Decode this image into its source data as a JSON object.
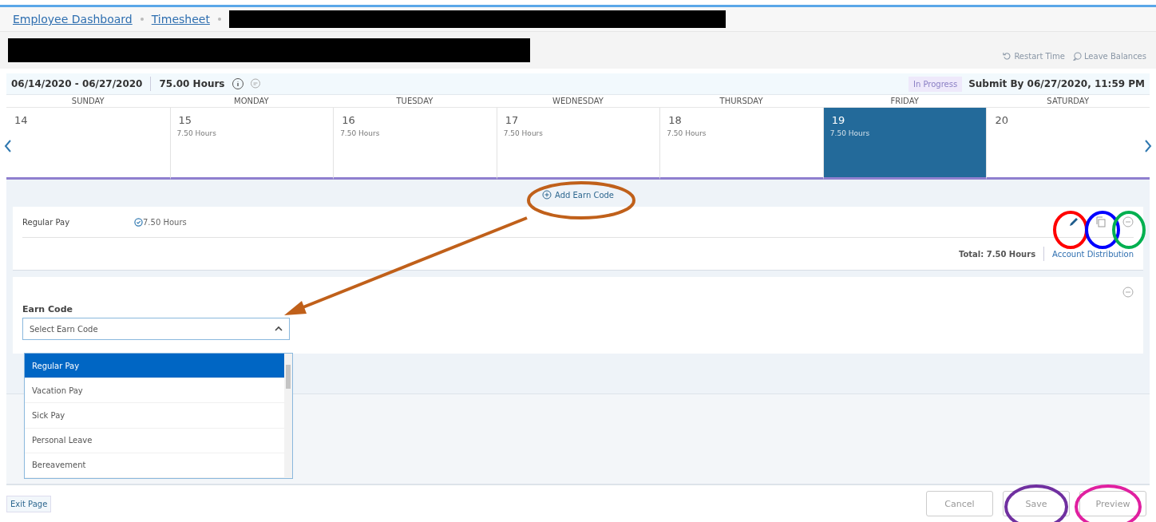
{
  "breadcrumbs": [
    {
      "label": "Employee Dashboard"
    },
    {
      "label": "Timesheet"
    }
  ],
  "header_links": [
    {
      "kind": "restart",
      "label": "Restart Time"
    },
    {
      "kind": "balances",
      "label": "Leave Balances"
    }
  ],
  "period": {
    "range": "06/14/2020 - 06/27/2020",
    "hours": "75.00 Hours",
    "status": "In Progress",
    "submit_by": "Submit By 06/27/2020, 11:59 PM"
  },
  "days": [
    {
      "weekday": "SUNDAY",
      "date": "14",
      "selected": false
    },
    {
      "weekday": "MONDAY",
      "date": "15",
      "hours": "7.50 Hours",
      "selected": false
    },
    {
      "weekday": "TUESDAY",
      "date": "16",
      "hours": "7.50 Hours",
      "selected": false
    },
    {
      "weekday": "WEDNESDAY",
      "date": "17",
      "hours": "7.50 Hours",
      "selected": false
    },
    {
      "weekday": "THURSDAY",
      "date": "18",
      "hours": "7.50 Hours",
      "selected": false
    },
    {
      "weekday": "FRIDAY",
      "date": "19",
      "hours": "7.50 Hours",
      "selected": true
    },
    {
      "weekday": "SATURDAY",
      "date": "20",
      "selected": false
    }
  ],
  "add_earn_code": "Add Earn Code",
  "entries": [
    {
      "earn_code": "Regular Pay",
      "hours": "7.50 Hours",
      "total": "Total: 7.50 Hours",
      "link": "Account Distribution"
    }
  ],
  "new_entry": {
    "label": "Earn Code",
    "placeholder": "Select Earn Code",
    "expanded": true,
    "options": [
      {
        "label": "Regular Pay",
        "selected": true
      },
      {
        "label": "Vacation Pay",
        "selected": false
      },
      {
        "label": "Sick Pay",
        "selected": false
      },
      {
        "label": "Personal Leave",
        "selected": false
      },
      {
        "label": "Bereavement",
        "selected": false
      }
    ]
  },
  "footer": {
    "exit": "Exit Page",
    "buttons": [
      "Cancel",
      "Save",
      "Preview"
    ]
  },
  "annotations": [
    {
      "kind": "ellipse",
      "color": "#c0601a"
    },
    {
      "kind": "arrow",
      "color": "#c0601a"
    },
    {
      "kind": "ellipse",
      "color": "#ff0000"
    },
    {
      "kind": "ellipse",
      "color": "#0000ff"
    },
    {
      "kind": "ellipse",
      "color": "#00b050"
    },
    {
      "kind": "ellipse",
      "color": "#7030a0"
    },
    {
      "kind": "ellipse",
      "color": "#e020a0"
    }
  ]
}
